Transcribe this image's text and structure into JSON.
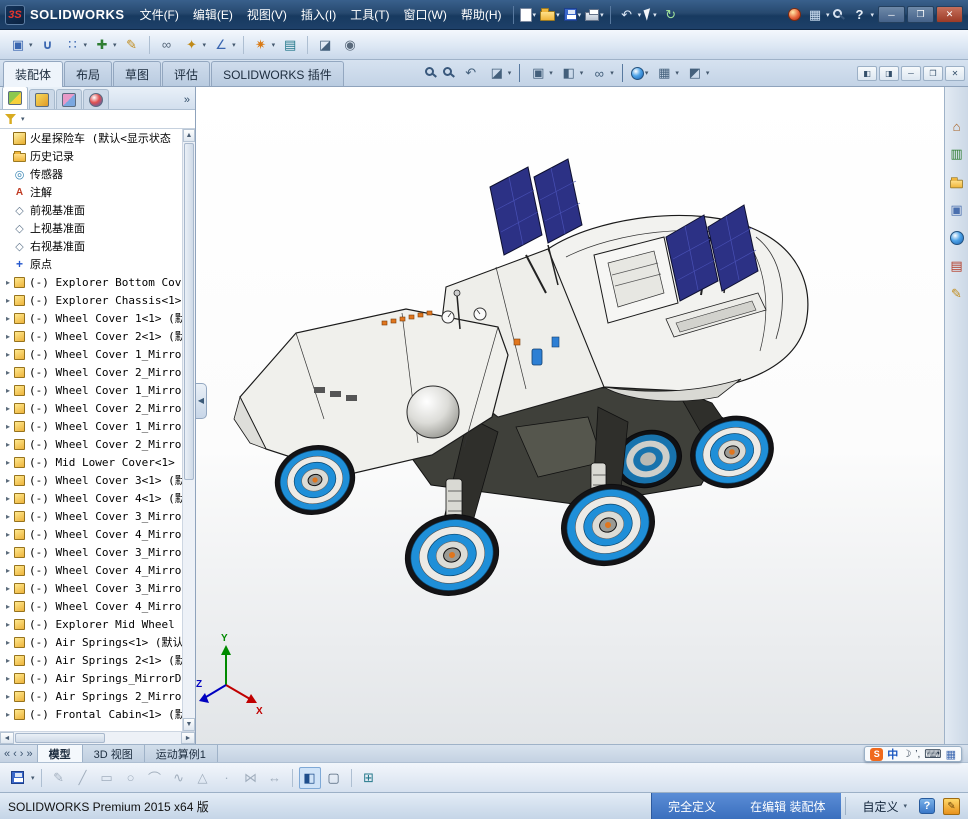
{
  "colors": {
    "title_blue": "#1e4069",
    "status_blue": "#3a6fbe",
    "wheel_blue": "#1f8fd8",
    "solar_panel_blue": "#2c3185",
    "sogou_orange": "#f06a1d",
    "accent_orange": "#e0761e"
  },
  "titlebar": {
    "logo_mark": "3S",
    "logo_text": "SOLIDWORKS",
    "menus": [
      {
        "label": "文件(F)"
      },
      {
        "label": "编辑(E)"
      },
      {
        "label": "视图(V)"
      },
      {
        "label": "插入(I)"
      },
      {
        "label": "工具(T)"
      },
      {
        "label": "窗口(W)"
      },
      {
        "label": "帮助(H)"
      }
    ]
  },
  "icons": {
    "dropdown": "▾",
    "chevron_double": "»",
    "collapse_left": "◀",
    "undo": "↶",
    "rebuild": "↻",
    "min": "─",
    "restore": "❒",
    "close": "✕",
    "pane_left": "◧",
    "pane_right": "◨",
    "nav_first": "«",
    "nav_prev": "‹",
    "nav_next": "›",
    "nav_last": "»",
    "scroll_up": "▲",
    "scroll_down": "▼",
    "scroll_left": "◄",
    "scroll_right": "►",
    "widget": "▣",
    "mate": "∪",
    "pattern": "∷",
    "insert_plus": "✚",
    "edit_pencil": "✎",
    "hidden": "∞",
    "feature_star": "✦",
    "ref_geo": "∠",
    "explode": "✷",
    "bom": "▤",
    "section": "◪",
    "camera": "◉",
    "view_cube": "▣",
    "display_style": "◧",
    "scene": "▦",
    "view_settings": "◩",
    "prev_view": "↶",
    "grid_display": "▦",
    "question": "?",
    "home": "⌂",
    "library": "▥",
    "documents": "▣",
    "props": "▤",
    "line": "╱",
    "circle": "○",
    "arc": "⌒",
    "spline": "∿",
    "rect": "▭",
    "poly": "△",
    "point": "·",
    "mirror": "⋈",
    "dim": "↔",
    "grid": "⊞",
    "table": "⊞",
    "shaded": "◧",
    "wireframe": "▢"
  },
  "command_bar": {
    "tabs": [
      {
        "label": "装配体",
        "cls": "active"
      },
      {
        "label": "布局"
      },
      {
        "label": "草图"
      },
      {
        "label": "评估"
      },
      {
        "label": "SOLIDWORKS 插件"
      }
    ]
  },
  "feature_tree": {
    "root_label": "火星探险车 (默认<显示状态",
    "items": [
      {
        "icon": "folder",
        "label": "历史记录"
      },
      {
        "icon": "sensor",
        "label": "传感器"
      },
      {
        "icon": "ann",
        "label": "注解"
      },
      {
        "icon": "plane",
        "label": "前视基准面"
      },
      {
        "icon": "plane",
        "label": "上视基准面"
      },
      {
        "icon": "plane",
        "label": "右视基准面"
      },
      {
        "icon": "origin",
        "label": "原点"
      },
      {
        "icon": "part",
        "exp": "▸",
        "label": "(-) Explorer Bottom Cov"
      },
      {
        "icon": "part",
        "exp": "▸",
        "label": "(-) Explorer Chassis<1>"
      },
      {
        "icon": "part",
        "exp": "▸",
        "label": "(-) Wheel Cover 1<1> (默"
      },
      {
        "icon": "part",
        "exp": "▸",
        "label": "(-) Wheel Cover 2<1> (默"
      },
      {
        "icon": "part",
        "exp": "▸",
        "label": "(-) Wheel Cover 1_Mirro"
      },
      {
        "icon": "part",
        "exp": "▸",
        "label": "(-) Wheel Cover 2_Mirro"
      },
      {
        "icon": "part",
        "exp": "▸",
        "label": "(-) Wheel Cover 1_Mirro"
      },
      {
        "icon": "part",
        "exp": "▸",
        "label": "(-) Wheel Cover 2_Mirro"
      },
      {
        "icon": "part",
        "exp": "▸",
        "label": "(-) Wheel Cover 1_Mirro"
      },
      {
        "icon": "part",
        "exp": "▸",
        "label": "(-) Wheel Cover 2_Mirro"
      },
      {
        "icon": "part",
        "exp": "▸",
        "label": "(-) Mid Lower Cover<1>"
      },
      {
        "icon": "part",
        "exp": "▸",
        "label": "(-) Wheel Cover 3<1> (默"
      },
      {
        "icon": "part",
        "exp": "▸",
        "label": "(-) Wheel Cover 4<1> (默"
      },
      {
        "icon": "part",
        "exp": "▸",
        "label": "(-) Wheel Cover 3_Mirro"
      },
      {
        "icon": "part",
        "exp": "▸",
        "label": "(-) Wheel Cover 4_Mirro"
      },
      {
        "icon": "part",
        "exp": "▸",
        "label": "(-) Wheel Cover 3_Mirro"
      },
      {
        "icon": "part",
        "exp": "▸",
        "label": "(-) Wheel Cover 4_Mirro"
      },
      {
        "icon": "part",
        "exp": "▸",
        "label": "(-) Wheel Cover 3_Mirro"
      },
      {
        "icon": "part",
        "exp": "▸",
        "label": "(-) Wheel Cover 4_Mirro"
      },
      {
        "icon": "part",
        "exp": "▸",
        "label": "(-) Explorer Mid Wheel"
      },
      {
        "icon": "part",
        "exp": "▸",
        "label": "(-) Air Springs<1> (默认"
      },
      {
        "icon": "part",
        "exp": "▸",
        "label": "(-) Air Springs 2<1> (默"
      },
      {
        "icon": "part",
        "exp": "▸",
        "label": "(-) Air Springs_MirrorD"
      },
      {
        "icon": "part",
        "exp": "▸",
        "label": "(-) Air Springs 2_Mirro"
      },
      {
        "icon": "part",
        "exp": "▸",
        "label": "(-) Frontal Cabin<1> (默"
      }
    ]
  },
  "viewport": {
    "triad": {
      "x": "X",
      "y": "Y",
      "z": "Z"
    }
  },
  "bottom_tabs": {
    "tabs": [
      {
        "label": "模型",
        "cls": "active"
      },
      {
        "label": "3D 视图"
      },
      {
        "label": "运动算例1"
      }
    ]
  },
  "lang_bar": {
    "ime": "S",
    "lang": "中",
    "shape": "☽",
    "punct": "’,",
    "keyboard": "⌨",
    "toolbox": "▦"
  },
  "status_bar": {
    "left": "SOLIDWORKS Premium 2015 x64 版",
    "defined": "完全定义",
    "editing": "在编辑 装配体",
    "custom": "自定义"
  }
}
